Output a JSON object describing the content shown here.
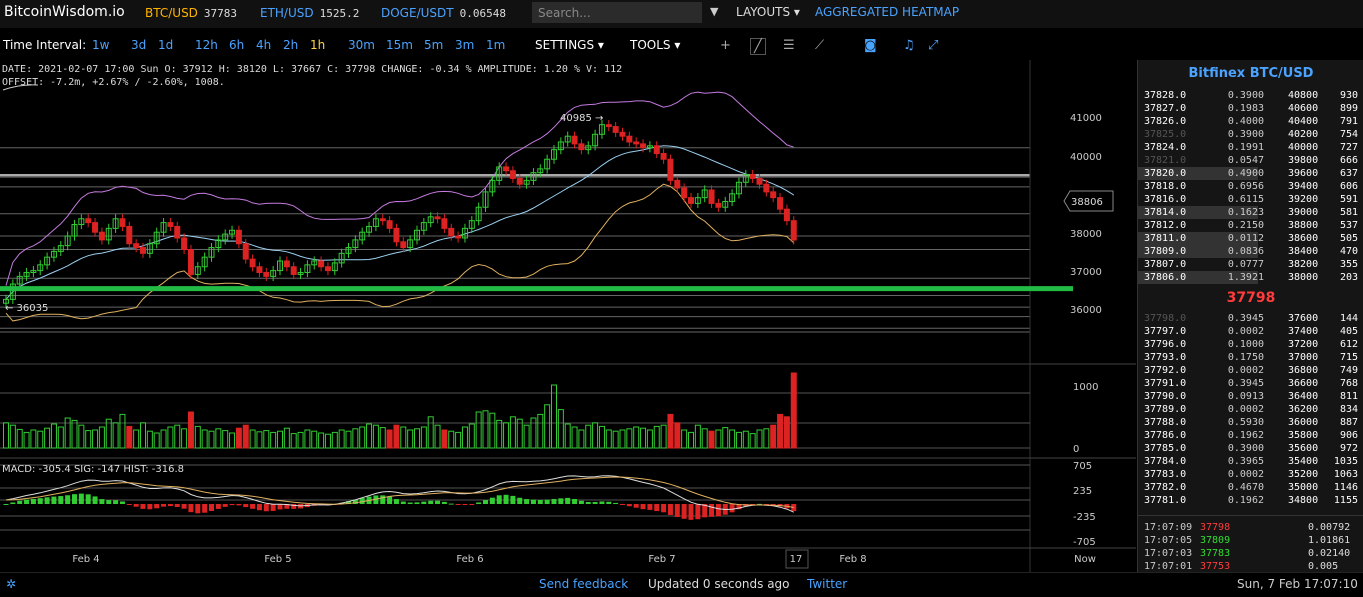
{
  "app": {
    "logo": "BitcoinWisdom.io"
  },
  "tickers": [
    {
      "symbol": "BTC/USD",
      "value": "37783",
      "active": true
    },
    {
      "symbol": "ETH/USD",
      "value": "1525.2",
      "active": false
    },
    {
      "symbol": "DOGE/USDT",
      "value": "0.06548",
      "active": false
    }
  ],
  "search": {
    "placeholder": "Search..."
  },
  "topnav": {
    "layouts": "LAYOUTS",
    "heatmap": "AGGREGATED HEATMAP"
  },
  "toolbar": {
    "label": "Time Interval:",
    "intervals": [
      "1w",
      "3d",
      "1d",
      "12h",
      "6h",
      "4h",
      "2h",
      "1h",
      "30m",
      "15m",
      "5m",
      "3m",
      "1m"
    ],
    "selected": "1h",
    "settings": "SETTINGS",
    "tools": "TOOLS"
  },
  "info": {
    "line1": "DATE: 2021-02-07 17:00 Sun   O: 37912   H: 38120   L: 37667   C: 37798   CHANGE:  -0.34 %   AMPLITUDE: 1.20 %   V: 112",
    "line2": "OFFSET: -7.2m, +2.67% / -2.60%, 1008."
  },
  "chart_data": {
    "type": "candlestick",
    "price_axis": [
      "41000",
      "40000",
      "39000",
      "38000",
      "37000",
      "36000"
    ],
    "current_price_label": "38806",
    "high_marker": "40985",
    "low_marker": "36035",
    "volume_axis": [
      "1000",
      "0"
    ],
    "macd_axis": [
      "705",
      "235",
      "-235",
      "-705"
    ],
    "macd_label": "MACD: -305.4   SIG: -147   HIST: -316.8",
    "x_labels": [
      "Feb 4",
      "Feb 5",
      "Feb 6",
      "Feb 7",
      "17",
      "Feb 8",
      "Now"
    ],
    "closes": [
      36250,
      36650,
      36850,
      36950,
      37000,
      37150,
      37350,
      37500,
      37650,
      37900,
      38200,
      38350,
      38250,
      38000,
      37800,
      38100,
      38350,
      38150,
      37700,
      37600,
      37450,
      37700,
      38000,
      38250,
      38150,
      37850,
      37550,
      36900,
      37100,
      37350,
      37600,
      37800,
      37950,
      38050,
      37700,
      37300,
      37100,
      36950,
      36850,
      37000,
      37250,
      37100,
      36900,
      36950,
      37150,
      37250,
      37100,
      37000,
      37200,
      37450,
      37600,
      37800,
      38000,
      38150,
      38350,
      38300,
      38100,
      37750,
      37600,
      37800,
      38050,
      38250,
      38400,
      38350,
      38100,
      37900,
      37850,
      38100,
      38300,
      38650,
      39050,
      39350,
      39700,
      39600,
      39400,
      39250,
      39350,
      39550,
      39650,
      39900,
      40150,
      40350,
      40500,
      40300,
      40150,
      40250,
      40550,
      40800,
      40750,
      40600,
      40500,
      40350,
      40300,
      40200,
      40250,
      40050,
      39900,
      39350,
      39150,
      38900,
      38750,
      38900,
      39100,
      38750,
      38650,
      38800,
      39000,
      39300,
      39500,
      39400,
      39250,
      39050,
      38900,
      38600,
      38300,
      37798
    ],
    "volumes": [
      420,
      380,
      310,
      260,
      300,
      280,
      330,
      400,
      350,
      500,
      460,
      380,
      290,
      300,
      350,
      480,
      420,
      560,
      360,
      300,
      420,
      280,
      250,
      300,
      350,
      380,
      320,
      600,
      360,
      300,
      280,
      320,
      290,
      250,
      330,
      380,
      300,
      270,
      290,
      260,
      280,
      330,
      240,
      260,
      300,
      280,
      250,
      230,
      260,
      300,
      280,
      320,
      350,
      400,
      380,
      340,
      300,
      380,
      350,
      300,
      320,
      350,
      520,
      380,
      300,
      280,
      260,
      350,
      400,
      600,
      620,
      580,
      460,
      420,
      520,
      480,
      380,
      500,
      560,
      720,
      1050,
      640,
      400,
      350,
      300,
      380,
      420,
      360,
      300,
      280,
      300,
      320,
      350,
      330,
      300,
      360,
      380,
      560,
      420,
      300,
      260,
      380,
      320,
      280,
      300,
      340,
      300,
      260,
      280,
      240,
      300,
      320,
      380,
      560,
      520,
      1250
    ],
    "volume_colors_red_idx": [
      18,
      27,
      34,
      35,
      56,
      57,
      64,
      97,
      98,
      103,
      112,
      113,
      114,
      115
    ],
    "support_level": 36530,
    "hlines": [
      40200,
      39490,
      39440,
      39180,
      38480,
      37900,
      37550,
      36800,
      36350,
      36050,
      35800,
      35500,
      35400
    ]
  },
  "orderbook": {
    "title": "Bitfinex BTC/USD",
    "mid": "37798",
    "asks": [
      [
        "37828.0",
        "00",
        "0.3900",
        "40800",
        "930"
      ],
      [
        "37827.0",
        "00",
        "0.1983",
        "40600",
        "899"
      ],
      [
        "37826.0",
        "00",
        "0.4000",
        "40400",
        "791"
      ],
      [
        "37825.0",
        "00",
        "0.3900",
        "40200",
        "754"
      ],
      [
        "37824.0",
        "00",
        "0.1991",
        "40000",
        "727"
      ],
      [
        "37821.0",
        "00",
        "0.0547",
        "39800",
        "666"
      ],
      [
        "37820.0",
        "00",
        "0.4900",
        "39600",
        "637"
      ],
      [
        "37818.0",
        "00",
        "0.6956",
        "39400",
        "606"
      ],
      [
        "37816.0",
        "00",
        "0.6115",
        "39200",
        "591"
      ],
      [
        "37814.0",
        "00",
        "0.1623",
        "39000",
        "581"
      ],
      [
        "37812.0",
        "00",
        "0.2150",
        "38800",
        "537"
      ],
      [
        "37811.0",
        "00",
        "0.0112",
        "38600",
        "505"
      ],
      [
        "37809.0",
        "00",
        "0.0836",
        "38400",
        "470"
      ],
      [
        "37807.0",
        "00",
        "0.0777",
        "38200",
        "355"
      ],
      [
        "37806.0",
        "00",
        "1.3921",
        "38000",
        "203"
      ]
    ],
    "bids": [
      [
        "37798.0",
        "00",
        "0.3945",
        "37600",
        "144"
      ],
      [
        "37797.0",
        "00",
        "0.0002",
        "37400",
        "405"
      ],
      [
        "37796.0",
        "00",
        "0.1000",
        "37200",
        "612"
      ],
      [
        "37793.0",
        "00",
        "0.1750",
        "37000",
        "715"
      ],
      [
        "37792.0",
        "00",
        "0.0002",
        "36800",
        "749"
      ],
      [
        "37791.0",
        "00",
        "0.3945",
        "36600",
        "768"
      ],
      [
        "37790.0",
        "00",
        "0.0913",
        "36400",
        "811"
      ],
      [
        "37789.0",
        "00",
        "0.0002",
        "36200",
        "834"
      ],
      [
        "37788.0",
        "00",
        "0.5930",
        "36000",
        "887"
      ],
      [
        "37786.0",
        "00",
        "0.1962",
        "35800",
        "906"
      ],
      [
        "37785.0",
        "00",
        "0.3900",
        "35600",
        "972"
      ],
      [
        "37784.0",
        "00",
        "0.3965",
        "35400",
        "1035"
      ],
      [
        "37783.0",
        "00",
        "0.0002",
        "35200",
        "1063"
      ],
      [
        "37782.0",
        "00",
        "0.4670",
        "35000",
        "1146"
      ],
      [
        "37781.0",
        "00",
        "0.1962",
        "34800",
        "1155"
      ]
    ],
    "trades": [
      [
        "17:07:09",
        "37798",
        "0.00792",
        "red"
      ],
      [
        "17:07:05",
        "37809",
        "1.01861",
        "green"
      ],
      [
        "17:07:03",
        "37783",
        "0.02140",
        "green"
      ],
      [
        "17:07:01",
        "37753",
        "0.005",
        "red"
      ]
    ]
  },
  "status": {
    "feedback": "Send feedback",
    "updated": "Updated 0 seconds ago",
    "twitter": "Twitter",
    "clock": "Sun, 7 Feb 17:07:10"
  },
  "colors": {
    "up": "#33cc33",
    "down": "#dd2222",
    "accent": "#4aa3ff",
    "support": "#22bb44"
  }
}
